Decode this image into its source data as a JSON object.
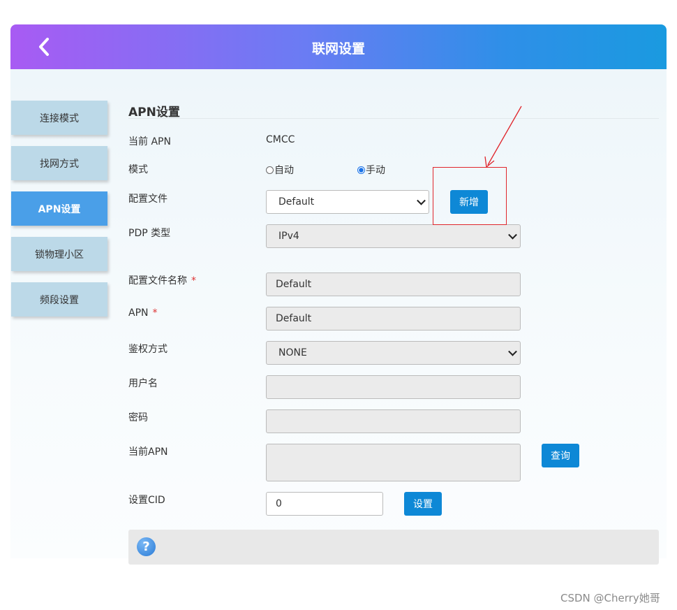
{
  "header": {
    "title": "联网设置"
  },
  "sidebar": {
    "items": [
      {
        "label": "连接模式"
      },
      {
        "label": "找网方式"
      },
      {
        "label": "APN设置"
      },
      {
        "label": "锁物理小区"
      },
      {
        "label": "频段设置"
      }
    ]
  },
  "apn": {
    "section_title": "APN设置",
    "current_apn_label": "当前 APN",
    "current_apn_value": "CMCC",
    "mode_label": "模式",
    "mode_options": [
      "自动",
      "手动"
    ],
    "mode_selected": "手动",
    "profile_label": "配置文件",
    "profile_value": "Default",
    "add_button": "新增",
    "pdp_label": "PDP 类型",
    "pdp_value": "IPv4",
    "profile_name_label": "配置文件名称",
    "profile_name_value": "Default",
    "apn_label": "APN",
    "apn_value": "Default",
    "required_mark": "*",
    "auth_label": "鉴权方式",
    "auth_value": "NONE",
    "username_label": "用户名",
    "username_value": "",
    "password_label": "密码",
    "password_value": "",
    "current_apn2_label": "当前APN",
    "query_button": "查询",
    "cid_label": "设置CID",
    "cid_value": "0",
    "set_button": "设置"
  },
  "help": {
    "icon": "?"
  },
  "watermark": "CSDN @Cherry她哥",
  "colors": {
    "accent": "#0e88d6",
    "sidebar_active": "#4a9fe8",
    "sidebar": "#bcd9e8",
    "annotation": "#e0252b"
  }
}
